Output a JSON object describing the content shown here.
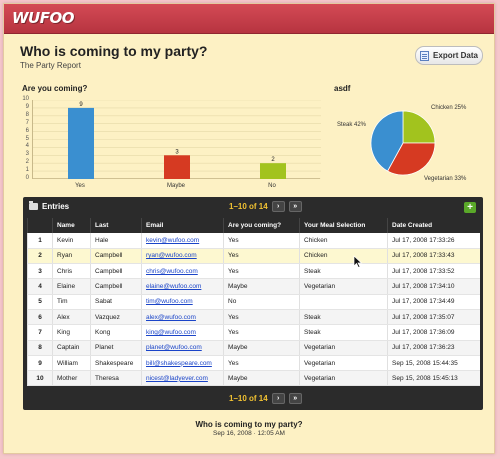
{
  "app": {
    "logo": "WUFOO"
  },
  "header": {
    "title": "Who is coming to my party?",
    "subtitle": "The Party Report",
    "export_label": "Export Data"
  },
  "bar_chart_title": "Are you coming?",
  "pie_chart_title": "asdf",
  "chart_data": [
    {
      "type": "bar",
      "title": "Are you coming?",
      "categories": [
        "Yes",
        "Maybe",
        "No"
      ],
      "values": [
        9,
        3,
        2
      ],
      "value_labels": [
        "9",
        "3",
        "2"
      ],
      "colors": [
        "#3a8fd0",
        "#d63a22",
        "#a2c31e"
      ],
      "ylim": [
        0,
        10
      ],
      "yticks": [
        "0",
        "1",
        "2",
        "3",
        "4",
        "5",
        "6",
        "7",
        "8",
        "9",
        "10"
      ],
      "grid": true
    },
    {
      "type": "pie",
      "title": "asdf",
      "labels": [
        "Chicken 25%",
        "Vegetarian 33%",
        "Steak 42%"
      ],
      "values": [
        25,
        33,
        42
      ],
      "colors": [
        "#a2c31e",
        "#d63a22",
        "#3a8fd0"
      ]
    }
  ],
  "table": {
    "title": "Entries",
    "pager_text": "1–10 of 14",
    "next": "›",
    "last": "»",
    "add": "+",
    "columns": [
      "",
      "Name",
      "Last",
      "Email",
      "Are you coming?",
      "Your Meal Selection",
      "Date Created"
    ],
    "rows": [
      {
        "n": "1",
        "name": "Kevin",
        "last": "Hale",
        "email": "kevin@wufoo.com",
        "coming": "Yes",
        "meal": "Chicken",
        "date": "Jul 17, 2008 17:33:26"
      },
      {
        "n": "2",
        "name": "Ryan",
        "last": "Campbell",
        "email": "ryan@wufoo.com",
        "coming": "Yes",
        "meal": "Chicken",
        "date": "Jul 17, 2008 17:33:43"
      },
      {
        "n": "3",
        "name": "Chris",
        "last": "Campbell",
        "email": "chris@wufoo.com",
        "coming": "Yes",
        "meal": "Steak",
        "date": "Jul 17, 2008 17:33:52"
      },
      {
        "n": "4",
        "name": "Elaine",
        "last": "Campbell",
        "email": "elaine@wufoo.com",
        "coming": "Maybe",
        "meal": "Vegetarian",
        "date": "Jul 17, 2008 17:34:10"
      },
      {
        "n": "5",
        "name": "Tim",
        "last": "Sabat",
        "email": "tim@wufoo.com",
        "coming": "No",
        "meal": "",
        "date": "Jul 17, 2008 17:34:49"
      },
      {
        "n": "6",
        "name": "Alex",
        "last": "Vazquez",
        "email": "alex@wufoo.com",
        "coming": "Yes",
        "meal": "Steak",
        "date": "Jul 17, 2008 17:35:07"
      },
      {
        "n": "7",
        "name": "King",
        "last": "Kong",
        "email": "king@wufoo.com",
        "coming": "Yes",
        "meal": "Steak",
        "date": "Jul 17, 2008 17:36:09"
      },
      {
        "n": "8",
        "name": "Captain",
        "last": "Planet",
        "email": "planet@wufoo.com",
        "coming": "Maybe",
        "meal": "Vegetarian",
        "date": "Jul 17, 2008 17:36:23"
      },
      {
        "n": "9",
        "name": "William",
        "last": "Shakespeare",
        "email": "bill@shakespeare.com",
        "coming": "Yes",
        "meal": "Vegetarian",
        "date": "Sep 15, 2008 15:44:35"
      },
      {
        "n": "10",
        "name": "Mother",
        "last": "Theresa",
        "email": "nicest@ladyever.com",
        "coming": "Maybe",
        "meal": "Vegetarian",
        "date": "Sep 15, 2008 15:45:13"
      }
    ]
  },
  "footer": {
    "title": "Who is coming to my party?",
    "date": "Sep 16, 2008  ·  12:05 AM"
  }
}
